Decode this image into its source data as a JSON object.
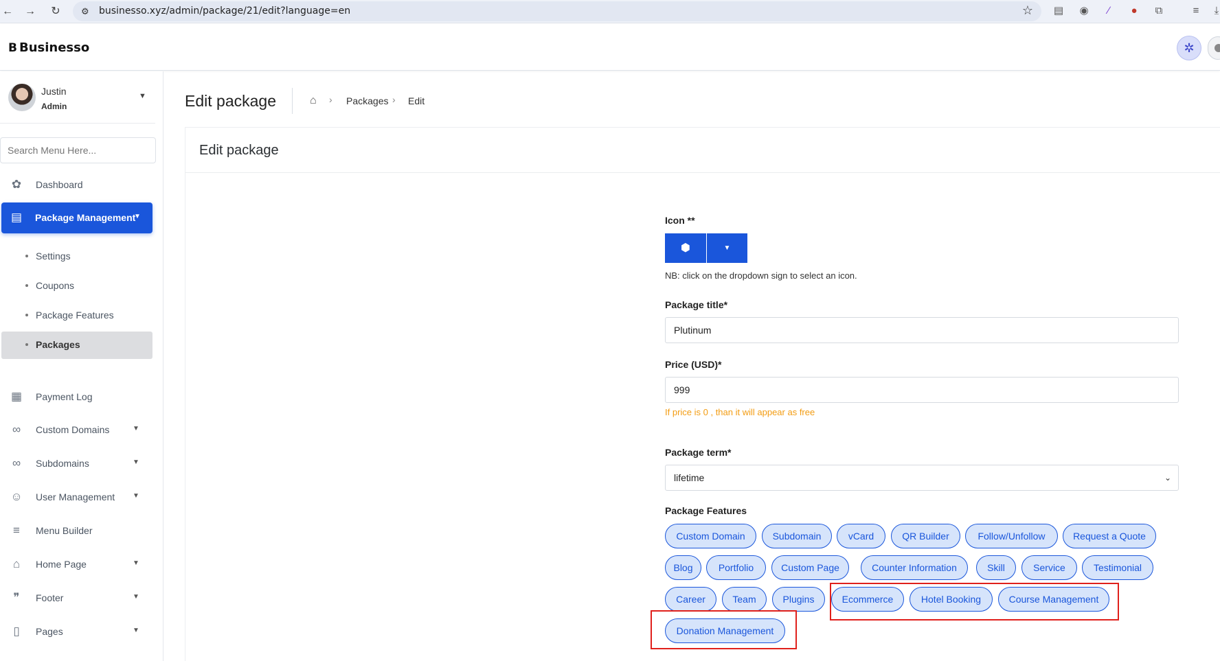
{
  "browser": {
    "url": "businesso.xyz/admin/package/21/edit?language=en"
  },
  "header": {
    "logo_text": "Businesso",
    "logo_mark": "B"
  },
  "sidebar": {
    "user_name": "Justin",
    "user_role": "Admin",
    "search_placeholder": "Search Menu Here...",
    "items": [
      {
        "label": "Dashboard",
        "icon": "palette-icon"
      },
      {
        "label": "Package Management",
        "icon": "receipt-icon",
        "active": true
      },
      {
        "label": "Payment Log",
        "icon": "invoice-icon"
      },
      {
        "label": "Custom Domains",
        "icon": "link-icon"
      },
      {
        "label": "Subdomains",
        "icon": "link-icon"
      },
      {
        "label": "User Management",
        "icon": "users-icon"
      },
      {
        "label": "Menu Builder",
        "icon": "bars-icon"
      },
      {
        "label": "Home Page",
        "icon": "home-icon"
      },
      {
        "label": "Footer",
        "icon": "shoe-prints-icon"
      },
      {
        "label": "Pages",
        "icon": "file-icon"
      }
    ],
    "subitems": [
      {
        "label": "Settings"
      },
      {
        "label": "Coupons"
      },
      {
        "label": "Package Features"
      },
      {
        "label": "Packages",
        "active": true
      }
    ]
  },
  "page": {
    "title": "Edit package",
    "breadcrumb": [
      "Packages",
      "Edit"
    ],
    "card_title": "Edit package"
  },
  "form": {
    "icon_label": "Icon **",
    "icon_note": "NB: click on the dropdown sign to select an icon.",
    "title_label": "Package title*",
    "title_value": "Plutinum",
    "price_label": "Price (USD)*",
    "price_value": "999",
    "price_hint": "If price is 0 , than it will appear as free",
    "term_label": "Package term*",
    "term_value": "lifetime",
    "features_label": "Package Features",
    "features": [
      "Custom Domain",
      "Subdomain",
      "vCard",
      "QR Builder",
      "Follow/Unfollow",
      "Request a Quote",
      "Blog",
      "Portfolio",
      "Custom Page",
      "Counter Information",
      "Skill",
      "Service",
      "Testimonial",
      "Career",
      "Team",
      "Plugins",
      "Ecommerce",
      "Hotel Booking",
      "Course Management",
      "Donation Management"
    ]
  },
  "colors": {
    "primary": "#1a56db",
    "chip_bg": "#d6e4fb",
    "hint": "#f39c12",
    "highlight": "#e0201b"
  }
}
